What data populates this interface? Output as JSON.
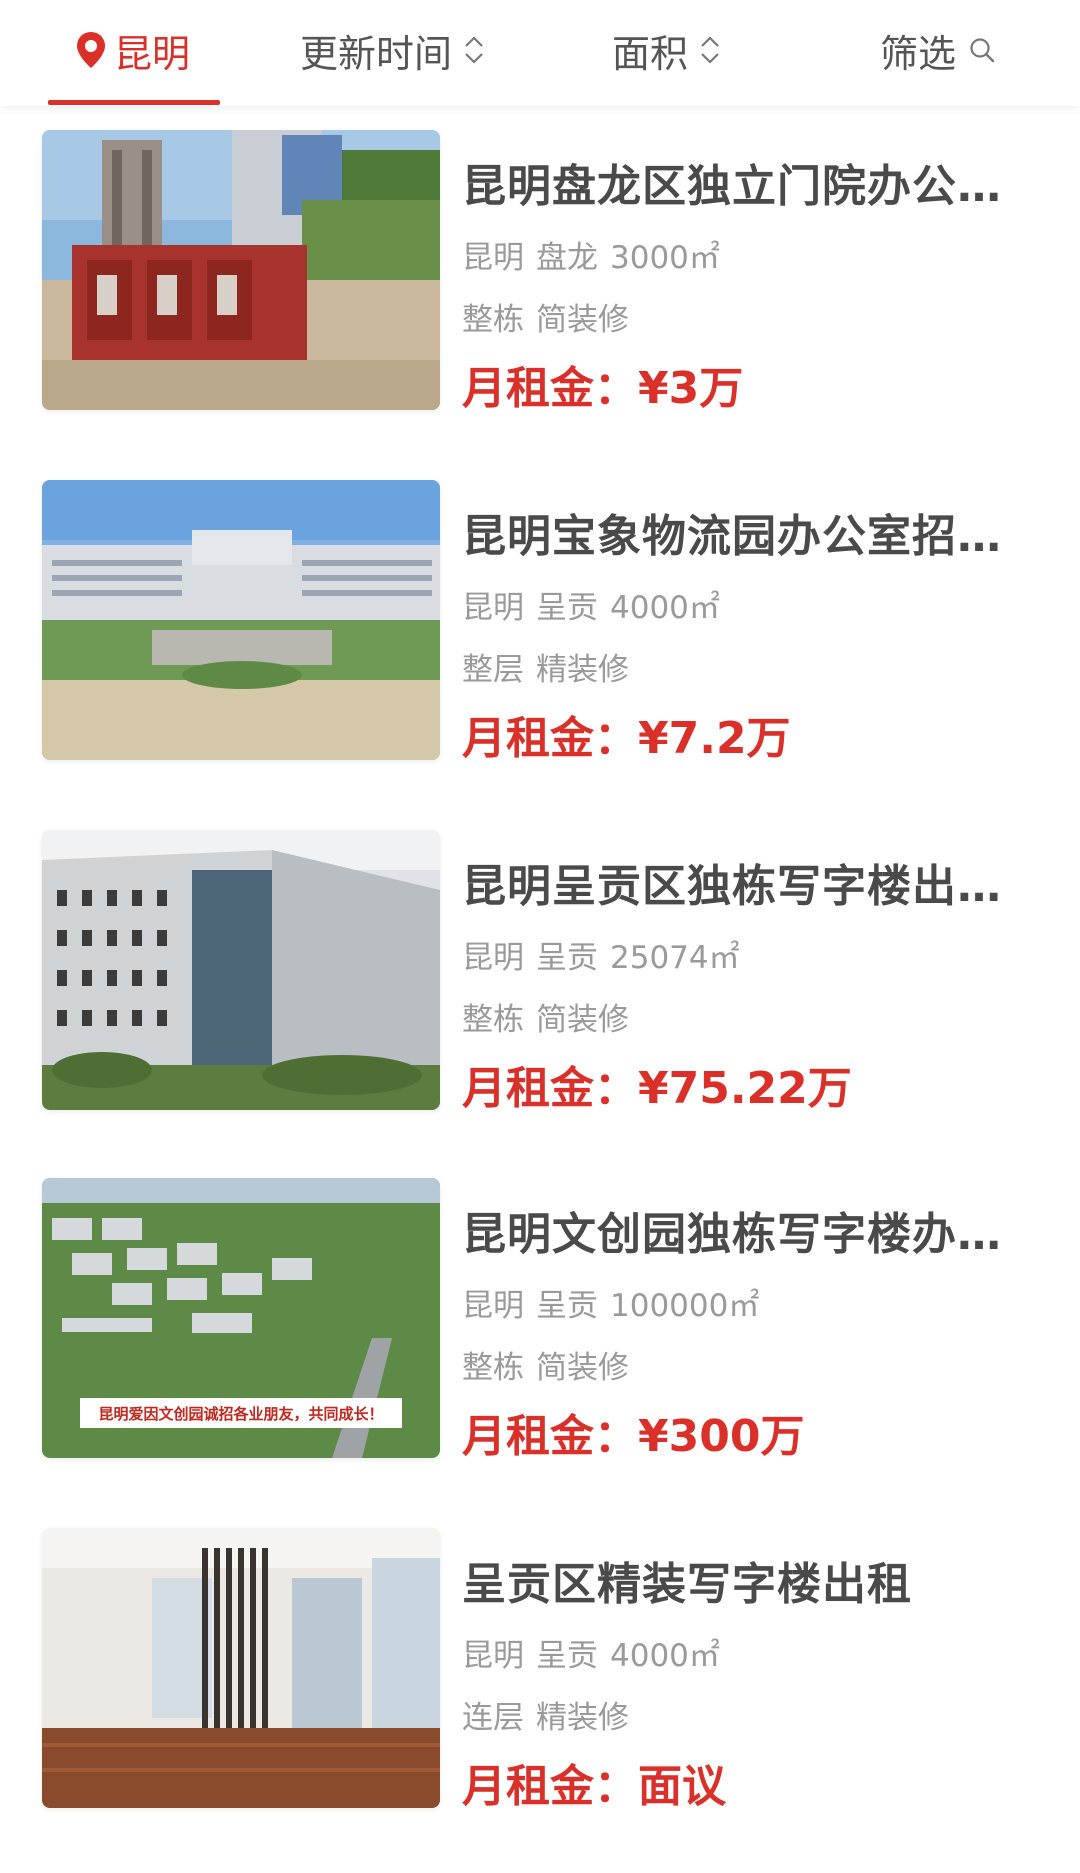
{
  "colors": {
    "accent": "#d9302a",
    "title_text": "#4a4a4a",
    "meta_text": "#9a9a9a"
  },
  "filter_bar": {
    "city": {
      "label": "昆明",
      "icon": "location-pin-icon",
      "active": true
    },
    "sort_time": {
      "label": "更新时间",
      "icon": "sort-arrows-icon"
    },
    "sort_area": {
      "label": "面积",
      "icon": "sort-arrows-icon"
    },
    "filter": {
      "label": "筛选",
      "icon": "search-icon"
    }
  },
  "price_label": "月租金：",
  "listings": [
    {
      "title": "昆明盘龙区独立门院办公…",
      "city": "昆明",
      "district": "盘龙",
      "area": "3000㎡",
      "layout": "整栋",
      "decoration": "简装修",
      "price": "¥3万",
      "image": "red-gate-courtyard-photo"
    },
    {
      "title": "昆明宝象物流园办公室招…",
      "city": "昆明",
      "district": "呈贡",
      "area": "4000㎡",
      "layout": "整层",
      "decoration": "精装修",
      "price": "¥7.2万",
      "image": "logistics-center-building-photo"
    },
    {
      "title": "昆明呈贡区独栋写字楼出…",
      "city": "昆明",
      "district": "呈贡",
      "area": "25074㎡",
      "layout": "整栋",
      "decoration": "简装修",
      "price": "¥75.22万",
      "image": "office-building-facade-photo"
    },
    {
      "title": "昆明文创园独栋写字楼办…",
      "city": "昆明",
      "district": "呈贡",
      "area": "100000㎡",
      "layout": "整栋",
      "decoration": "简装修",
      "price": "¥300万",
      "image": "creative-park-aerial-photo",
      "image_caption": "昆明爱因文创园诚招各业朋友，共同成长！"
    },
    {
      "title": "呈贡区精装写字楼出租",
      "city": "昆明",
      "district": "呈贡",
      "area": "4000㎡",
      "layout": "连层",
      "decoration": "精装修",
      "price": "面议",
      "image": "office-interior-photo"
    }
  ]
}
